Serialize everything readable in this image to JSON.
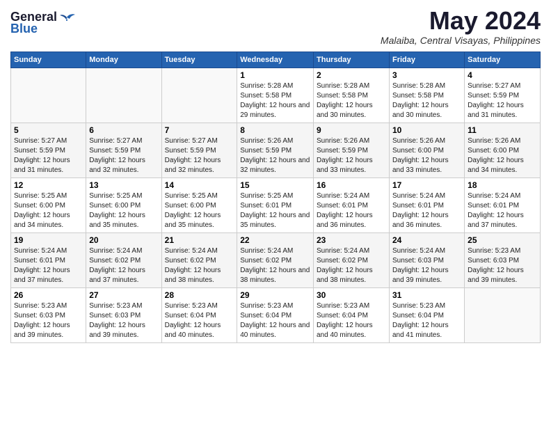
{
  "header": {
    "logo_general": "General",
    "logo_blue": "Blue",
    "month_title": "May 2024",
    "location": "Malaiba, Central Visayas, Philippines"
  },
  "calendar": {
    "days_of_week": [
      "Sunday",
      "Monday",
      "Tuesday",
      "Wednesday",
      "Thursday",
      "Friday",
      "Saturday"
    ],
    "weeks": [
      [
        {
          "day": "",
          "sunrise": "",
          "sunset": "",
          "daylight": ""
        },
        {
          "day": "",
          "sunrise": "",
          "sunset": "",
          "daylight": ""
        },
        {
          "day": "",
          "sunrise": "",
          "sunset": "",
          "daylight": ""
        },
        {
          "day": "1",
          "sunrise": "Sunrise: 5:28 AM",
          "sunset": "Sunset: 5:58 PM",
          "daylight": "Daylight: 12 hours and 29 minutes."
        },
        {
          "day": "2",
          "sunrise": "Sunrise: 5:28 AM",
          "sunset": "Sunset: 5:58 PM",
          "daylight": "Daylight: 12 hours and 30 minutes."
        },
        {
          "day": "3",
          "sunrise": "Sunrise: 5:28 AM",
          "sunset": "Sunset: 5:58 PM",
          "daylight": "Daylight: 12 hours and 30 minutes."
        },
        {
          "day": "4",
          "sunrise": "Sunrise: 5:27 AM",
          "sunset": "Sunset: 5:59 PM",
          "daylight": "Daylight: 12 hours and 31 minutes."
        }
      ],
      [
        {
          "day": "5",
          "sunrise": "Sunrise: 5:27 AM",
          "sunset": "Sunset: 5:59 PM",
          "daylight": "Daylight: 12 hours and 31 minutes."
        },
        {
          "day": "6",
          "sunrise": "Sunrise: 5:27 AM",
          "sunset": "Sunset: 5:59 PM",
          "daylight": "Daylight: 12 hours and 32 minutes."
        },
        {
          "day": "7",
          "sunrise": "Sunrise: 5:27 AM",
          "sunset": "Sunset: 5:59 PM",
          "daylight": "Daylight: 12 hours and 32 minutes."
        },
        {
          "day": "8",
          "sunrise": "Sunrise: 5:26 AM",
          "sunset": "Sunset: 5:59 PM",
          "daylight": "Daylight: 12 hours and 32 minutes."
        },
        {
          "day": "9",
          "sunrise": "Sunrise: 5:26 AM",
          "sunset": "Sunset: 5:59 PM",
          "daylight": "Daylight: 12 hours and 33 minutes."
        },
        {
          "day": "10",
          "sunrise": "Sunrise: 5:26 AM",
          "sunset": "Sunset: 6:00 PM",
          "daylight": "Daylight: 12 hours and 33 minutes."
        },
        {
          "day": "11",
          "sunrise": "Sunrise: 5:26 AM",
          "sunset": "Sunset: 6:00 PM",
          "daylight": "Daylight: 12 hours and 34 minutes."
        }
      ],
      [
        {
          "day": "12",
          "sunrise": "Sunrise: 5:25 AM",
          "sunset": "Sunset: 6:00 PM",
          "daylight": "Daylight: 12 hours and 34 minutes."
        },
        {
          "day": "13",
          "sunrise": "Sunrise: 5:25 AM",
          "sunset": "Sunset: 6:00 PM",
          "daylight": "Daylight: 12 hours and 35 minutes."
        },
        {
          "day": "14",
          "sunrise": "Sunrise: 5:25 AM",
          "sunset": "Sunset: 6:00 PM",
          "daylight": "Daylight: 12 hours and 35 minutes."
        },
        {
          "day": "15",
          "sunrise": "Sunrise: 5:25 AM",
          "sunset": "Sunset: 6:01 PM",
          "daylight": "Daylight: 12 hours and 35 minutes."
        },
        {
          "day": "16",
          "sunrise": "Sunrise: 5:24 AM",
          "sunset": "Sunset: 6:01 PM",
          "daylight": "Daylight: 12 hours and 36 minutes."
        },
        {
          "day": "17",
          "sunrise": "Sunrise: 5:24 AM",
          "sunset": "Sunset: 6:01 PM",
          "daylight": "Daylight: 12 hours and 36 minutes."
        },
        {
          "day": "18",
          "sunrise": "Sunrise: 5:24 AM",
          "sunset": "Sunset: 6:01 PM",
          "daylight": "Daylight: 12 hours and 37 minutes."
        }
      ],
      [
        {
          "day": "19",
          "sunrise": "Sunrise: 5:24 AM",
          "sunset": "Sunset: 6:01 PM",
          "daylight": "Daylight: 12 hours and 37 minutes."
        },
        {
          "day": "20",
          "sunrise": "Sunrise: 5:24 AM",
          "sunset": "Sunset: 6:02 PM",
          "daylight": "Daylight: 12 hours and 37 minutes."
        },
        {
          "day": "21",
          "sunrise": "Sunrise: 5:24 AM",
          "sunset": "Sunset: 6:02 PM",
          "daylight": "Daylight: 12 hours and 38 minutes."
        },
        {
          "day": "22",
          "sunrise": "Sunrise: 5:24 AM",
          "sunset": "Sunset: 6:02 PM",
          "daylight": "Daylight: 12 hours and 38 minutes."
        },
        {
          "day": "23",
          "sunrise": "Sunrise: 5:24 AM",
          "sunset": "Sunset: 6:02 PM",
          "daylight": "Daylight: 12 hours and 38 minutes."
        },
        {
          "day": "24",
          "sunrise": "Sunrise: 5:24 AM",
          "sunset": "Sunset: 6:03 PM",
          "daylight": "Daylight: 12 hours and 39 minutes."
        },
        {
          "day": "25",
          "sunrise": "Sunrise: 5:23 AM",
          "sunset": "Sunset: 6:03 PM",
          "daylight": "Daylight: 12 hours and 39 minutes."
        }
      ],
      [
        {
          "day": "26",
          "sunrise": "Sunrise: 5:23 AM",
          "sunset": "Sunset: 6:03 PM",
          "daylight": "Daylight: 12 hours and 39 minutes."
        },
        {
          "day": "27",
          "sunrise": "Sunrise: 5:23 AM",
          "sunset": "Sunset: 6:03 PM",
          "daylight": "Daylight: 12 hours and 39 minutes."
        },
        {
          "day": "28",
          "sunrise": "Sunrise: 5:23 AM",
          "sunset": "Sunset: 6:04 PM",
          "daylight": "Daylight: 12 hours and 40 minutes."
        },
        {
          "day": "29",
          "sunrise": "Sunrise: 5:23 AM",
          "sunset": "Sunset: 6:04 PM",
          "daylight": "Daylight: 12 hours and 40 minutes."
        },
        {
          "day": "30",
          "sunrise": "Sunrise: 5:23 AM",
          "sunset": "Sunset: 6:04 PM",
          "daylight": "Daylight: 12 hours and 40 minutes."
        },
        {
          "day": "31",
          "sunrise": "Sunrise: 5:23 AM",
          "sunset": "Sunset: 6:04 PM",
          "daylight": "Daylight: 12 hours and 41 minutes."
        },
        {
          "day": "",
          "sunrise": "",
          "sunset": "",
          "daylight": ""
        }
      ]
    ]
  }
}
